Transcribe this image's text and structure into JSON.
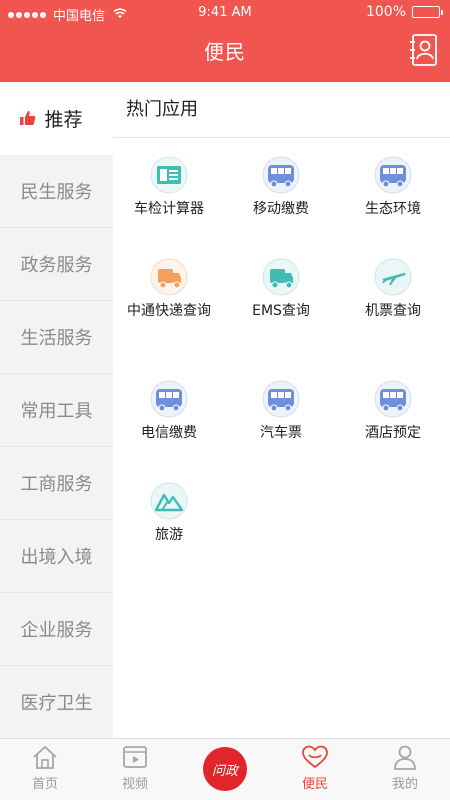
{
  "status_bar": {
    "carrier": "中国电信",
    "time": "9:41 AM",
    "battery": "100%"
  },
  "header": {
    "title": "便民",
    "contact_icon": "contact-card-icon"
  },
  "sidebar": {
    "items": [
      {
        "label": "推荐",
        "active": true
      },
      {
        "label": "民生服务"
      },
      {
        "label": "政务服务"
      },
      {
        "label": "生活服务"
      },
      {
        "label": "常用工具"
      },
      {
        "label": "工商服务"
      },
      {
        "label": "出境入境"
      },
      {
        "label": "企业服务"
      },
      {
        "label": "医疗卫生"
      }
    ]
  },
  "main": {
    "section_title": "热门应用",
    "apps": [
      {
        "label": "车检计算器",
        "icon": "id-card-icon"
      },
      {
        "label": "移动缴费",
        "icon": "bus-icon"
      },
      {
        "label": "生态环境",
        "icon": "bus-icon"
      },
      {
        "label": "中通快递查询",
        "icon": "delivery-icon"
      },
      {
        "label": "EMS查询",
        "icon": "delivery-icon"
      },
      {
        "label": "机票查询",
        "icon": "plane-icon"
      },
      {
        "label": "电信缴费",
        "icon": "bus-icon"
      },
      {
        "label": "汽车票",
        "icon": "bus-icon"
      },
      {
        "label": "酒店预定",
        "icon": "bus-icon"
      },
      {
        "label": "旅游",
        "icon": "mountain-icon"
      }
    ]
  },
  "tabbar": {
    "items": [
      {
        "label": "首页",
        "icon": "home-icon"
      },
      {
        "label": "视频",
        "icon": "video-icon"
      },
      {
        "label": "问政",
        "icon": "wenzheng-logo"
      },
      {
        "label": "便民",
        "icon": "heart-icon",
        "active": true
      },
      {
        "label": "我的",
        "icon": "person-icon"
      }
    ]
  },
  "colors": {
    "brand_red": "#f0554f",
    "active_tab": "#e8453c",
    "icon_blue": "#6e8fdc",
    "icon_teal": "#3dbdb6",
    "icon_orange": "#f2a05c"
  }
}
